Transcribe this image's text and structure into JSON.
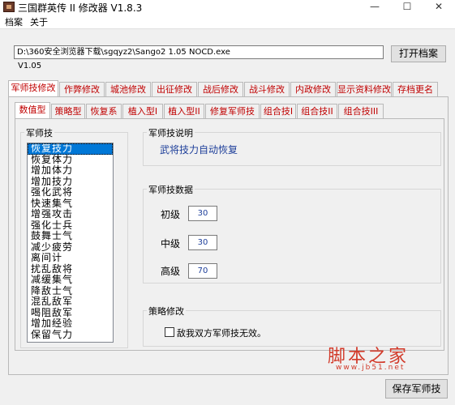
{
  "window": {
    "title": "三国群英传 II 修改器 V1.8.3",
    "minimize": "—",
    "maximize": "☐",
    "close": "✕"
  },
  "menu": [
    "档案",
    "关于"
  ],
  "file": {
    "path": "D:\\360安全浏览器下载\\sgqyz2\\Sango2 1.05 NOCD.exe",
    "open_button": "打开档案",
    "version": "V1.05"
  },
  "main_tabs": [
    "军师技修改",
    "作弊修改",
    "城池修改",
    "出征修改",
    "战后修改",
    "战斗修改",
    "内政修改",
    "显示资料修改",
    "存档更名"
  ],
  "sub_tabs": [
    "数值型",
    "策略型",
    "恢复系",
    "植入型I",
    "植入型II",
    "修复军师技",
    "组合技I",
    "组合技II",
    "组合技III"
  ],
  "skill_list": {
    "legend": "军师技",
    "selected_index": 0,
    "items": [
      "恢复技力",
      "恢复体力",
      "增加体力",
      "增加技力",
      "强化武将",
      "快速集气",
      "增强攻击",
      "强化士兵",
      "鼓舞士气",
      "减少疲劳",
      "离间计",
      "扰乱敌将",
      "减缓集气",
      "降敌士气",
      "混乱敌军",
      "喝阻敌军",
      "增加经验",
      "保留气力"
    ]
  },
  "description": {
    "legend": "军师技说明",
    "text": "武将技力自动恢复"
  },
  "skill_data": {
    "legend": "军师技数据",
    "levels": [
      {
        "label": "初级",
        "value": "30"
      },
      {
        "label": "中级",
        "value": "30"
      },
      {
        "label": "高级",
        "value": "70"
      }
    ]
  },
  "strategy": {
    "legend": "策略修改",
    "checkbox_label": "敌我双方军师技无效。",
    "checked": false
  },
  "save_button": "保存军师技",
  "watermark": {
    "text": "脚本之家",
    "url": "www.jb51.net"
  },
  "colors": {
    "tab_text": "#c00000",
    "selection": "#0078d7",
    "value_text": "#1e3f9a",
    "watermark": "#d23a2a"
  }
}
